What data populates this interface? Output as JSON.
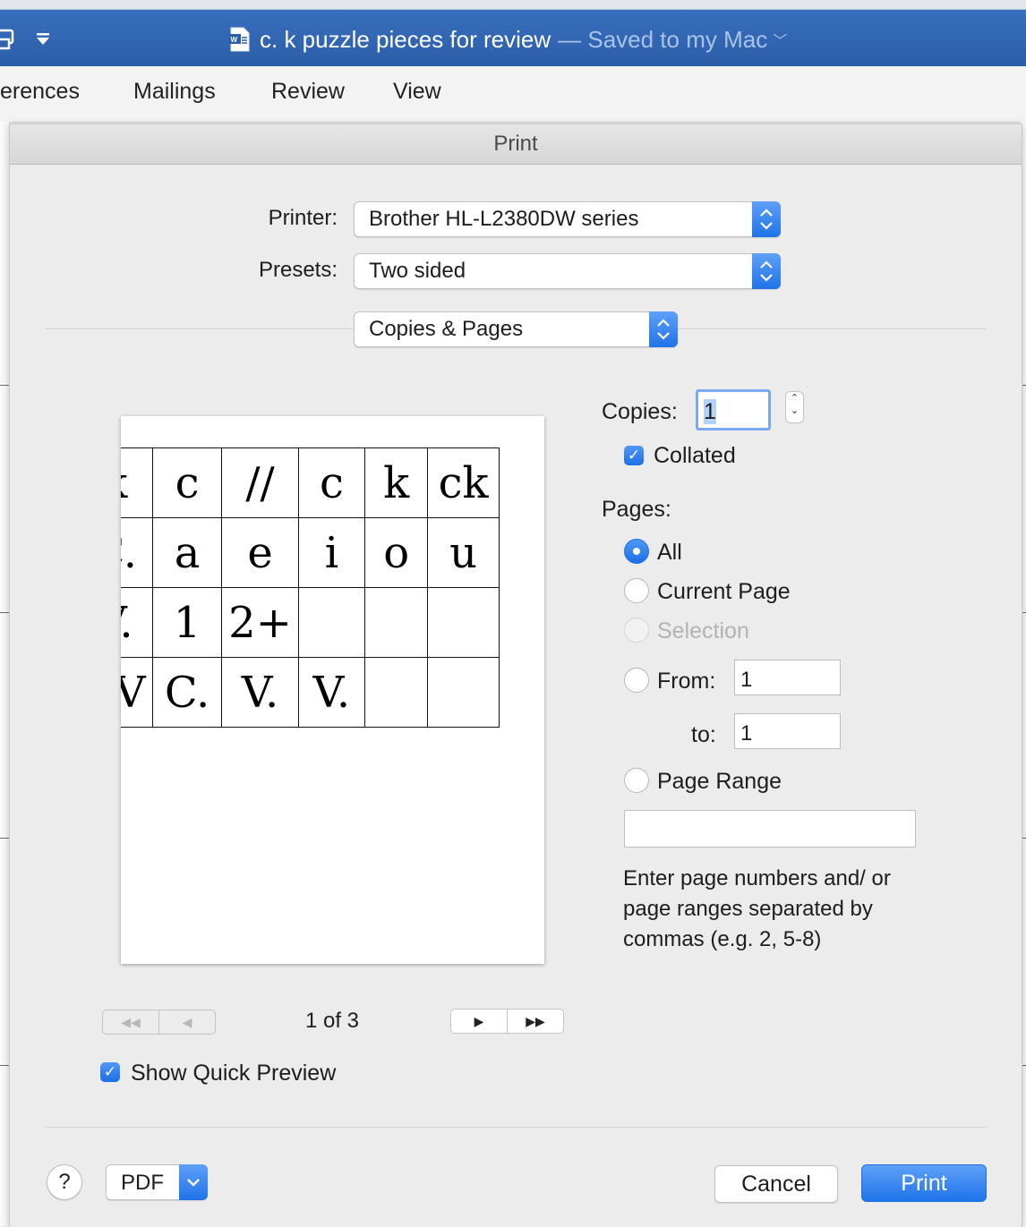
{
  "window": {
    "doc_title": "c. k puzzle pieces for review",
    "saved_status": "— Saved to my Mac",
    "ribbon_tabs": [
      "erences",
      "Mailings",
      "Review",
      "View"
    ]
  },
  "dialog": {
    "title": "Print",
    "printer_label": "Printer:",
    "printer_value": "Brother HL-L2380DW series",
    "presets_label": "Presets:",
    "presets_value": "Two sided",
    "section_value": "Copies & Pages",
    "preview": {
      "grid": [
        [
          "k",
          "c",
          "//",
          "c",
          "k",
          "ck"
        ],
        [
          "C.",
          "a",
          "e",
          "i",
          "o",
          "u"
        ],
        [
          "V.",
          "1",
          "2+",
          "",
          "",
          ""
        ],
        [
          "VV",
          "C.",
          "V.",
          "V.",
          "",
          ""
        ]
      ],
      "page_counter": "1 of 3",
      "nav_first": "◀◀",
      "nav_prev": "◀",
      "nav_next": "▶",
      "nav_last": "▶▶"
    },
    "show_quick_preview_label": "Show Quick Preview",
    "show_quick_preview_checked": true,
    "copies_label": "Copies:",
    "copies_value": "1",
    "collated_label": "Collated",
    "collated_checked": true,
    "pages_label": "Pages:",
    "pages_options": {
      "all": "All",
      "current": "Current Page",
      "selection": "Selection",
      "from": "From:",
      "to": "to:",
      "range": "Page Range"
    },
    "pages_selected": "All",
    "from_value": "1",
    "to_value": "1",
    "page_range_value": "",
    "help_text": "Enter page numbers and/ or page ranges separated by commas (e.g. 2, 5-8)",
    "help_button": "?",
    "pdf_button": "PDF",
    "cancel_button": "Cancel",
    "print_button": "Print"
  },
  "colors": {
    "accent": "#1f73e8",
    "titlebar": "#2f62ad"
  }
}
